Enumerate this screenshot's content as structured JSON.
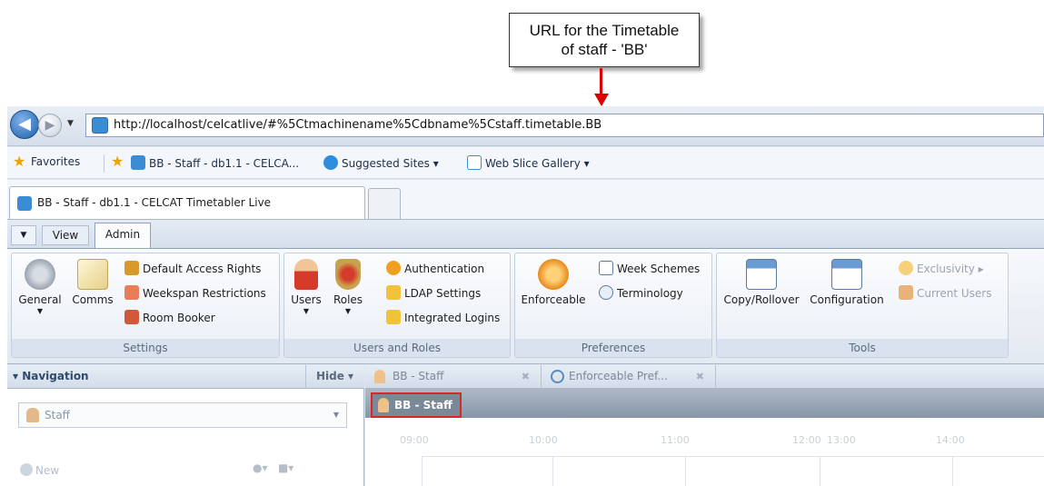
{
  "callout": {
    "line1": "URL for the Timetable",
    "line2": "of staff - 'BB'",
    "arrow_color": "#dd0000"
  },
  "browser": {
    "url": "http://localhost/celcatlive/#%5Ctmachinename%5Cdbname%5Cstaff.timetable.BB",
    "favorites_label": "Favorites",
    "fav_items": [
      {
        "label": "BB - Staff - db1.1 - CELCA...",
        "icon": "site-icon"
      },
      {
        "label": "Suggested Sites ▾",
        "icon": "ie-icon"
      },
      {
        "label": "Web Slice Gallery ▾",
        "icon": "slice-icon"
      }
    ],
    "tab_title": "BB - Staff - db1.1 - CELCAT Timetabler Live"
  },
  "ribbon": {
    "tabs": [
      "View",
      "Admin"
    ],
    "active_tab": "Admin",
    "groups": {
      "settings": {
        "label": "Settings",
        "general": "General",
        "comms": "Comms",
        "default_access": "Default Access Rights",
        "weekspan": "Weekspan Restrictions",
        "room_booker": "Room Booker"
      },
      "users_roles": {
        "label": "Users and Roles",
        "users": "Users",
        "roles": "Roles",
        "authentication": "Authentication",
        "ldap": "LDAP Settings",
        "integrated": "Integrated Logins"
      },
      "preferences": {
        "label": "Preferences",
        "enforceable": "Enforceable",
        "week_schemes": "Week Schemes",
        "terminology": "Terminology"
      },
      "tools": {
        "label": "Tools",
        "copy_rollover": "Copy/Rollover",
        "configuration": "Configuration",
        "exclusivity": "Exclusivity",
        "current_users": "Current Users"
      }
    }
  },
  "navigation": {
    "title": "▾ Navigation",
    "hide": "Hide ▾",
    "select_value": "Staff",
    "new_label": "New"
  },
  "content": {
    "tabs": [
      {
        "label": "BB - Staff",
        "close": "✖"
      },
      {
        "label": "Enforceable Pref...",
        "close": "✖"
      }
    ],
    "title": "BB - Staff",
    "hours": [
      "09:00",
      "10:00",
      "11:00",
      "12:00",
      "13:00",
      "14:00"
    ]
  },
  "colors": {
    "highlight_border": "#d62828",
    "ribbon_bg": "#e3e9f1"
  }
}
